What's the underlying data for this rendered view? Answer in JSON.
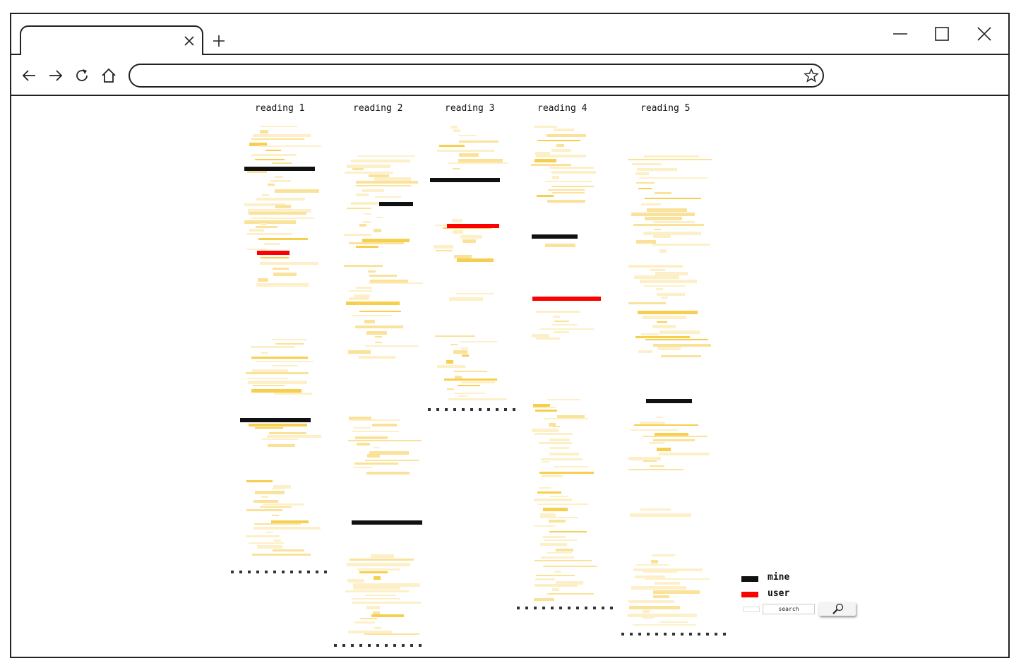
{
  "browser": {
    "tab_close_icon": "close-icon",
    "new_tab_icon": "plus-icon",
    "window_controls": [
      "minimize-icon",
      "maximize-icon",
      "close-icon"
    ],
    "nav_icons": [
      "back-arrow-icon",
      "forward-arrow-icon",
      "reload-icon",
      "home-icon"
    ],
    "address_value": "",
    "bookmark_icon": "star-icon"
  },
  "columns": [
    {
      "title": "reading 1"
    },
    {
      "title": "reading 2"
    },
    {
      "title": "reading 3"
    },
    {
      "title": "reading 4"
    },
    {
      "title": "reading 5"
    }
  ],
  "legend": {
    "mine_label": "mine",
    "user_label": "user",
    "mine_color": "#111111",
    "user_color": "#ff0000"
  },
  "search": {
    "value": "search",
    "button_icon": "magnifier-icon"
  },
  "colors": {
    "highlight_light": "#fdf0c8",
    "highlight_mid": "#fbe29a",
    "highlight_strong": "#f7cf4e"
  }
}
